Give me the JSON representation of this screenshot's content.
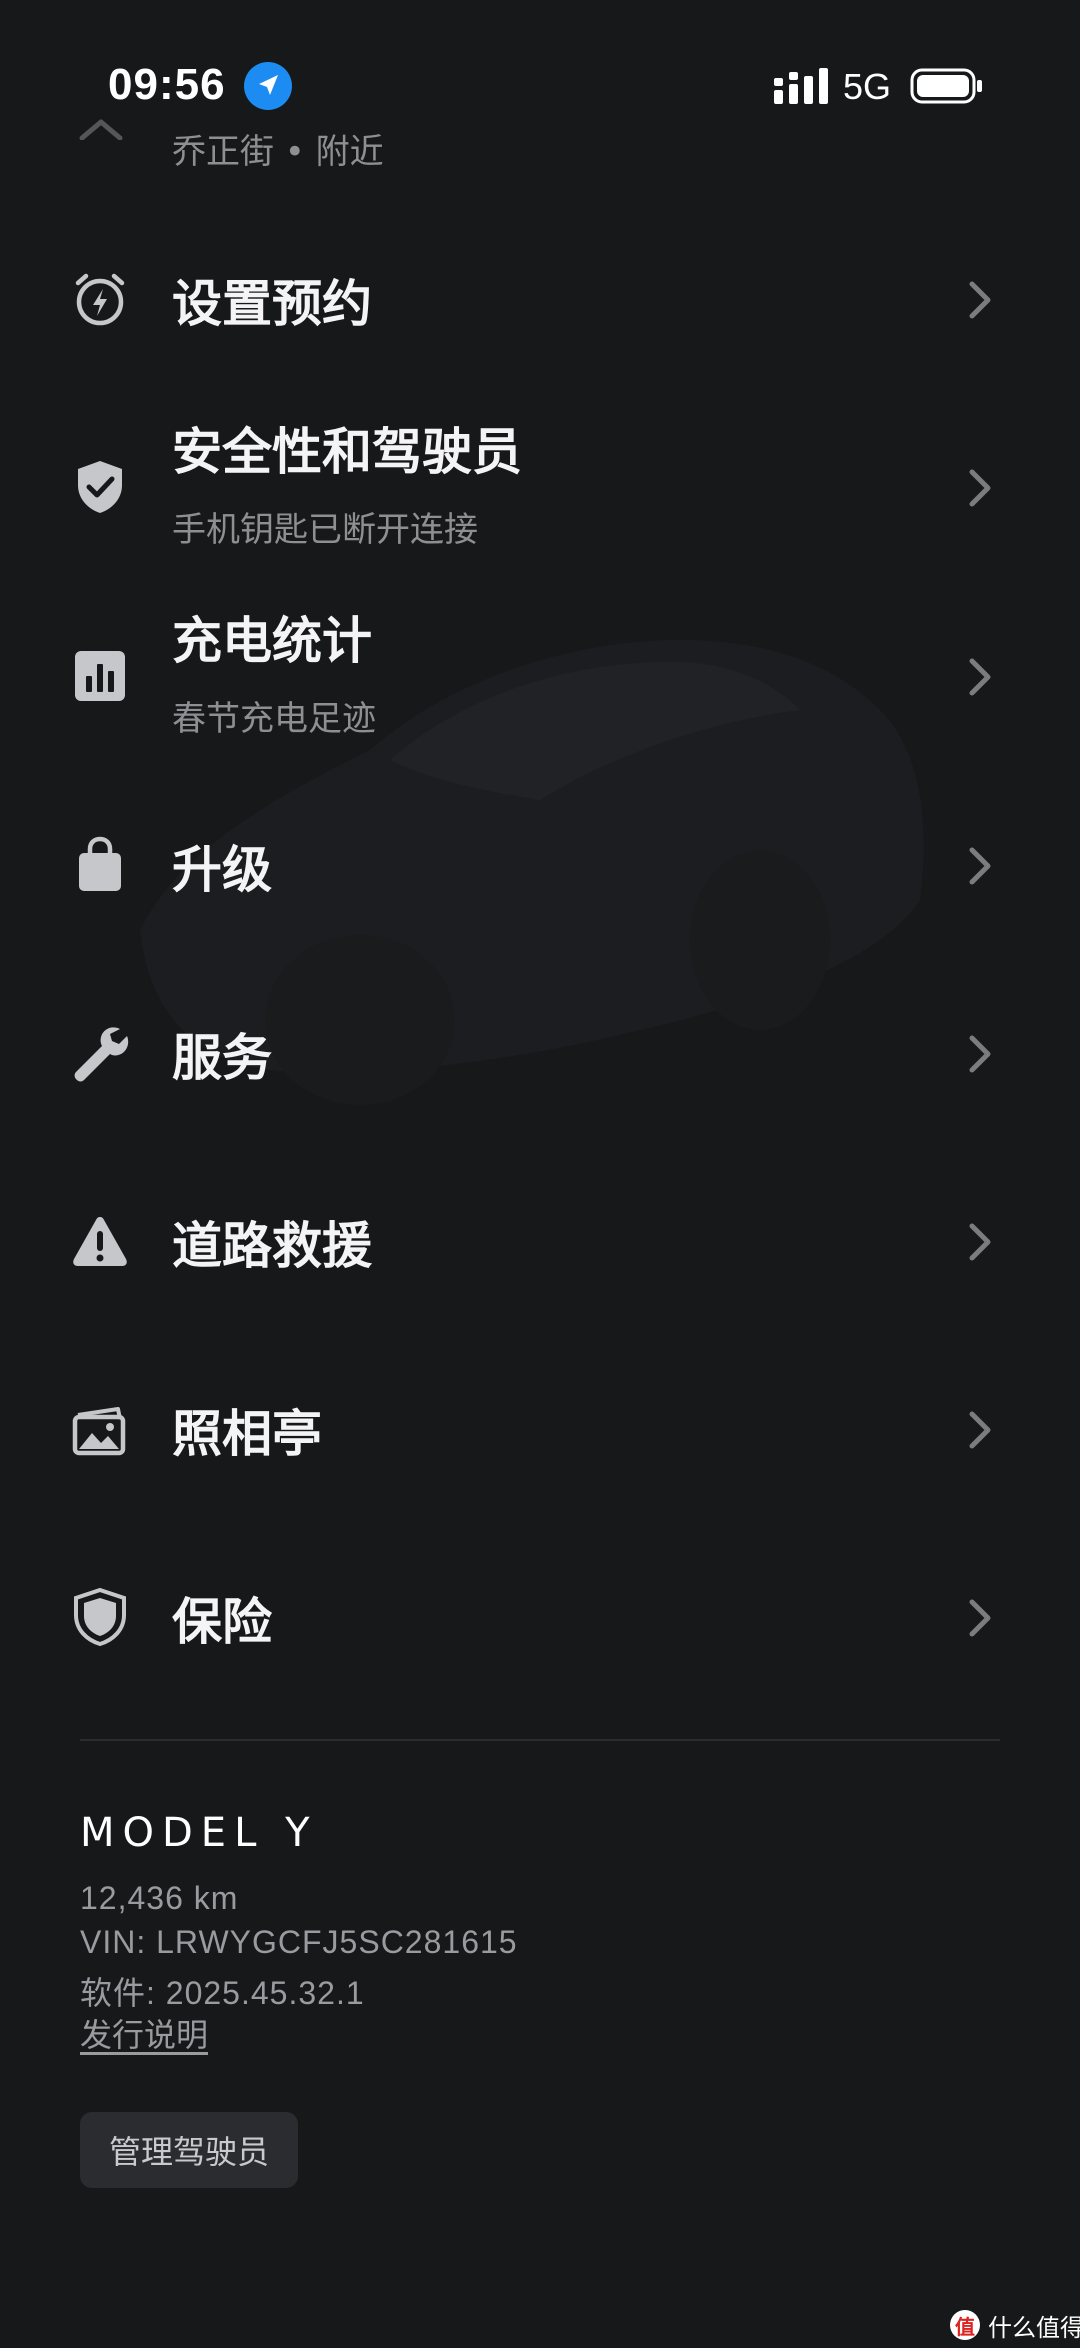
{
  "status_bar": {
    "time": "09:56",
    "network": "5G"
  },
  "partial_item": {
    "subtitle": "乔正街 • 附近"
  },
  "menu": [
    {
      "title": "设置预约",
      "subtitle": "",
      "icon": "alarm-bolt-icon"
    },
    {
      "title": "安全性和驾驶员",
      "subtitle": "手机钥匙已断开连接",
      "icon": "shield-check-icon"
    },
    {
      "title": "充电统计",
      "subtitle": "春节充电足迹",
      "icon": "bar-chart-icon"
    },
    {
      "title": "升级",
      "subtitle": "",
      "icon": "shopping-bag-icon"
    },
    {
      "title": "服务",
      "subtitle": "",
      "icon": "wrench-icon"
    },
    {
      "title": "道路救援",
      "subtitle": "",
      "icon": "warning-triangle-icon"
    },
    {
      "title": "照相亭",
      "subtitle": "",
      "icon": "photo-gallery-icon"
    },
    {
      "title": "保险",
      "subtitle": "",
      "icon": "shield-icon"
    }
  ],
  "vehicle": {
    "model_logo": "MODEL Y",
    "odometer": "12,436 km",
    "vin": "VIN: LRWYGCFJ5SC281615",
    "software": "软件: 2025.45.32.1",
    "release_notes_link": "发行说明",
    "manage_drivers_button": "管理驾驶员"
  },
  "watermark": {
    "logo_char": "值",
    "text": "什么值得买"
  },
  "colors": {
    "background": "#17181a",
    "text_primary": "#f4f4f6",
    "text_secondary": "#8e8f93",
    "icon": "#c6c7ca",
    "chevron": "#7b7c80",
    "location_badge": "#1d8cf2",
    "divider": "#2b2c30"
  }
}
